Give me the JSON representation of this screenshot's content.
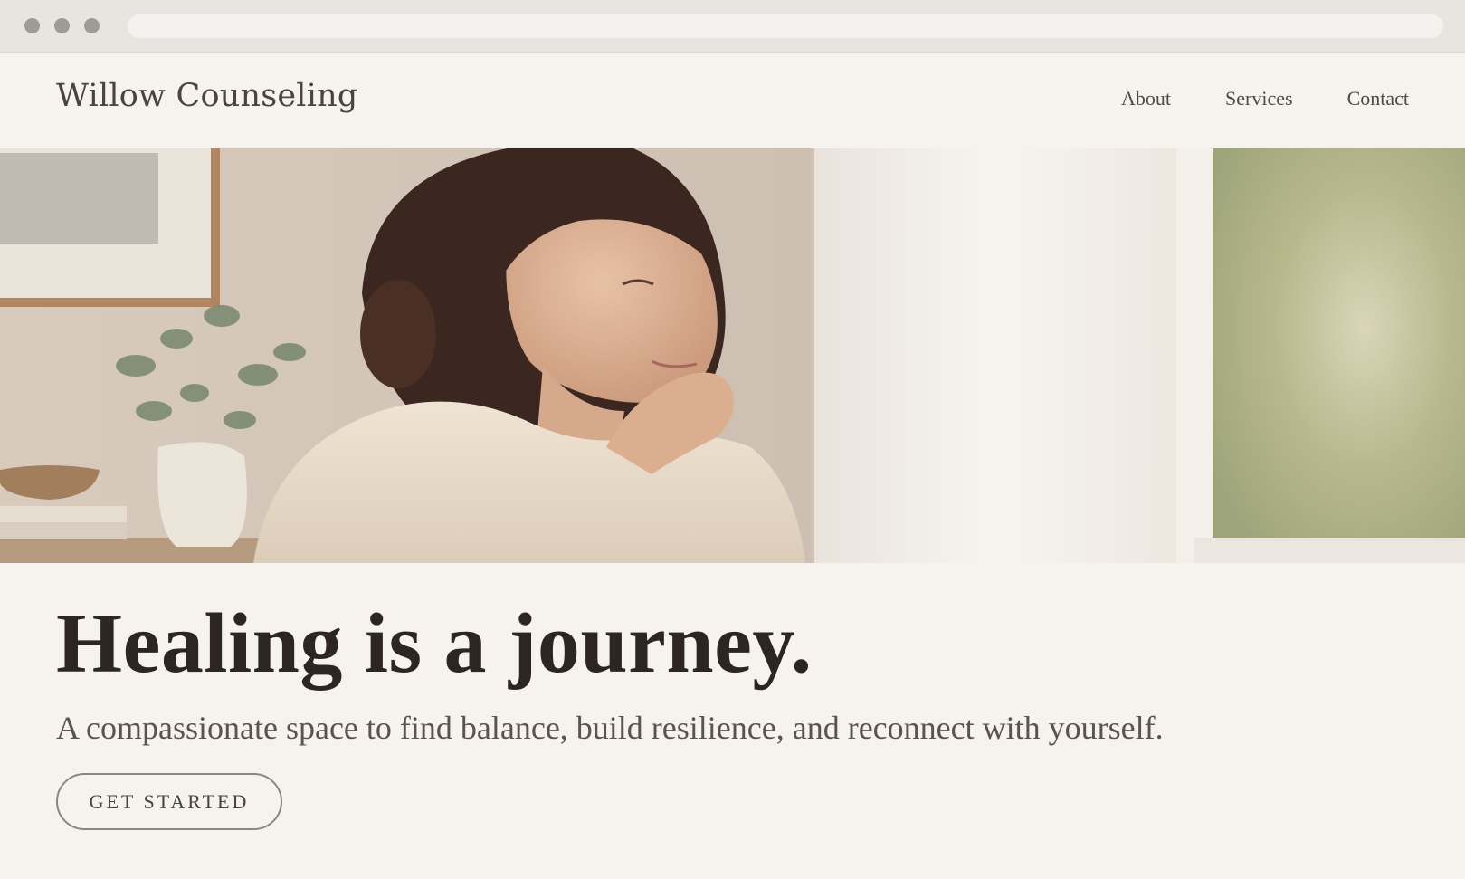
{
  "browser": {
    "address": ""
  },
  "header": {
    "brand": "Willow Counseling",
    "nav": [
      "About",
      "Services",
      "Contact"
    ]
  },
  "hero": {
    "image_subject": "woman-by-window-photo",
    "headline": "Healing is a journey.",
    "subheadline": "A compassionate space to find balance, build resilience, and reconnect with yourself.",
    "cta_label": "GET STARTED"
  },
  "colors": {
    "background": "#f6f3ee",
    "text_dark": "#2c2522",
    "text_muted": "#5b534e",
    "button_border": "#8d8580"
  }
}
